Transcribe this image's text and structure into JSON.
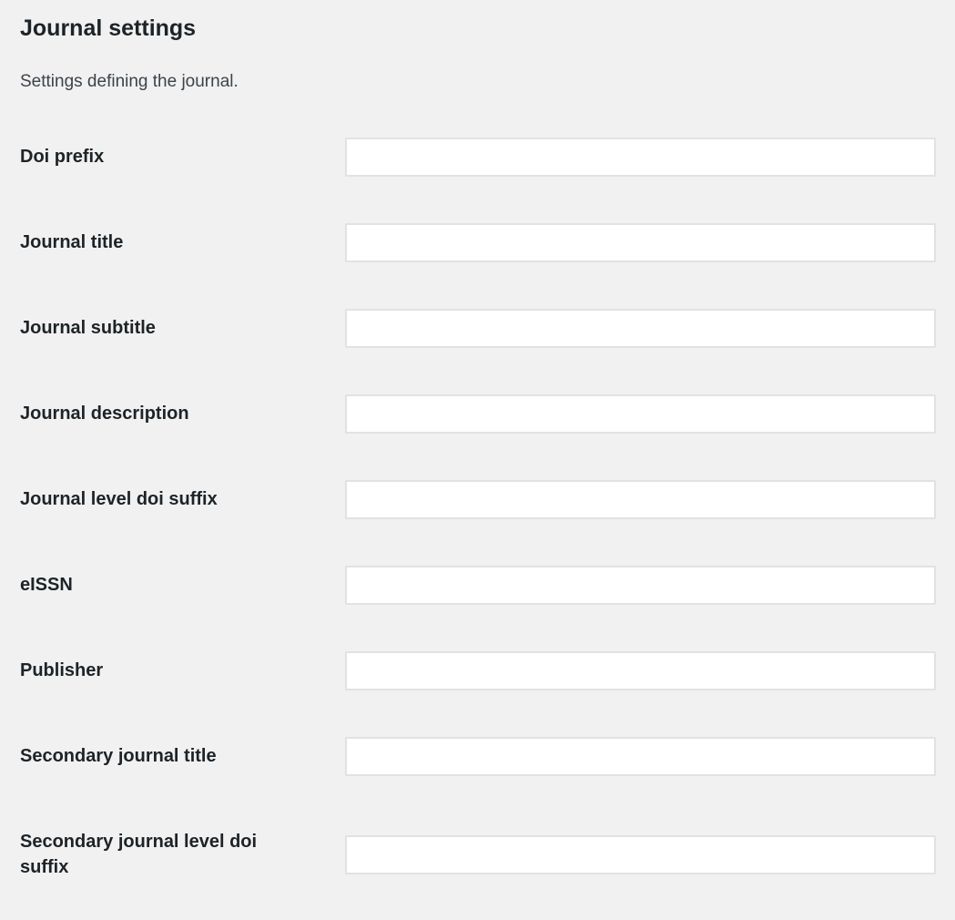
{
  "section": {
    "title": "Journal settings",
    "description": "Settings defining the journal."
  },
  "fields": [
    {
      "label": "Doi prefix",
      "value": "",
      "placeholder": ""
    },
    {
      "label": "Journal title",
      "value": "",
      "placeholder": ""
    },
    {
      "label": "Journal subtitle",
      "value": "",
      "placeholder": ""
    },
    {
      "label": "Journal description",
      "value": "",
      "placeholder": ""
    },
    {
      "label": "Journal level doi suffix",
      "value": "",
      "placeholder": ""
    },
    {
      "label": "eISSN",
      "value": "",
      "placeholder": ""
    },
    {
      "label": "Publisher",
      "value": "",
      "placeholder": ""
    },
    {
      "label": "Secondary journal title",
      "value": "",
      "placeholder": ""
    },
    {
      "label": "Secondary journal level doi suffix",
      "value": "",
      "placeholder": ""
    }
  ]
}
